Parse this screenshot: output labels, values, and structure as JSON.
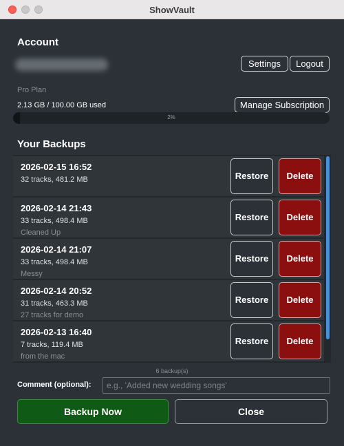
{
  "window": {
    "title": "ShowVault"
  },
  "account": {
    "heading": "Account",
    "settings_label": "Settings",
    "logout_label": "Logout",
    "plan": "Pro Plan",
    "usage": "2.13 GB / 100.00 GB used",
    "manage_label": "Manage Subscription",
    "usage_percent_label": "2%",
    "usage_fraction": 0.0213
  },
  "backups": {
    "heading": "Your Backups",
    "restore_label": "Restore",
    "delete_label": "Delete",
    "items": [
      {
        "date": "2026-02-15 16:52",
        "info": "32 tracks, 481.2 MB",
        "comment": ""
      },
      {
        "date": "2026-02-14 21:43",
        "info": "33 tracks, 498.4 MB",
        "comment": "Cleaned Up"
      },
      {
        "date": "2026-02-14 21:07",
        "info": "33 tracks, 498.4 MB",
        "comment": "Messy"
      },
      {
        "date": "2026-02-14 20:52",
        "info": "31 tracks, 463.3 MB",
        "comment": "27 tracks for demo"
      },
      {
        "date": "2026-02-13 16:40",
        "info": "7 tracks, 119.4 MB",
        "comment": "from the mac"
      }
    ],
    "count_label": "6 backup(s)"
  },
  "comment": {
    "label": "Comment (optional):",
    "placeholder": "e.g., 'Added new wedding songs'",
    "value": ""
  },
  "actions": {
    "backup_label": "Backup Now",
    "close_label": "Close"
  },
  "colors": {
    "background": "#2b3136",
    "delete": "#8b0f0f",
    "backup": "#0f5a14",
    "scrollbar": "#4a90d9"
  }
}
